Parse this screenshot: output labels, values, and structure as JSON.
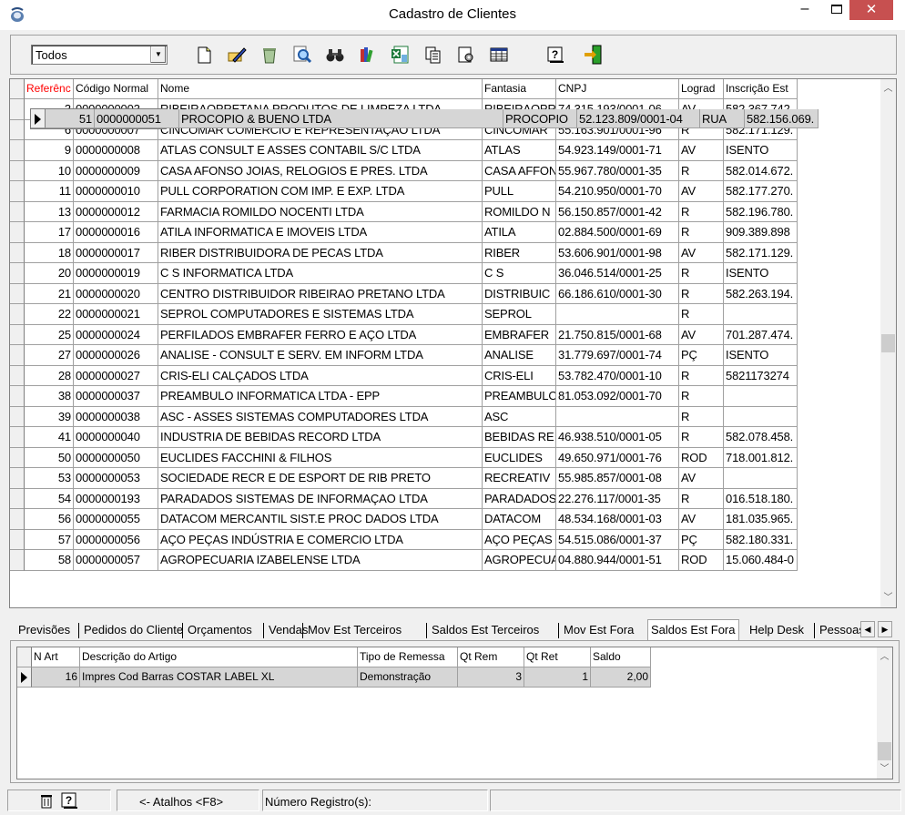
{
  "window": {
    "title": "Cadastro de Clientes",
    "minimize": "–",
    "close": "✕"
  },
  "toolbar": {
    "filter_value": "Todos",
    "icons": [
      "new-document-icon",
      "edit-icon",
      "recycle-bin-icon",
      "search-icon",
      "binoculars-icon",
      "bookshelf-icon",
      "excel-export-icon",
      "copy-icon",
      "settings-icon",
      "grid-icon",
      "help-icon",
      "exit-icon"
    ]
  },
  "grid": {
    "columns": [
      "Referênc",
      "Código Normal",
      "Nome",
      "Fantasia",
      "CNPJ",
      "Lograd",
      "Inscrição Est"
    ],
    "header_color_first": "#ff0000",
    "selected_index": 18,
    "rows": [
      [
        "3",
        "0000000003",
        "RIBEIRAOPRETANA PRODUTOS DE LIMPEZA LTDA",
        "RIBEIRAOPRE",
        "74.315.193/0001-06",
        "AV",
        "582.367.742."
      ],
      [
        "6",
        "0000000007",
        "CINCOMAR COMERCIO E REPRESENTAÇAO LTDA",
        "CINCOMAR",
        "55.163.901/0001-96",
        "R",
        "582.171.129."
      ],
      [
        "9",
        "0000000008",
        "ATLAS CONSULT E ASSES CONTABIL S/C LTDA",
        "ATLAS",
        "54.923.149/0001-71",
        "AV",
        "ISENTO"
      ],
      [
        "10",
        "0000000009",
        "CASA AFONSO JOIAS, RELOGIOS E PRES. LTDA",
        "CASA AFFON",
        "55.967.780/0001-35",
        "R",
        "582.014.672."
      ],
      [
        "11",
        "0000000010",
        "PULL CORPORATION COM IMP. E EXP. LTDA",
        "PULL",
        "54.210.950/0001-70",
        "AV",
        "582.177.270."
      ],
      [
        "13",
        "0000000012",
        "FARMACIA ROMILDO NOCENTI LTDA",
        "ROMILDO N",
        "56.150.857/0001-42",
        "R",
        "582.196.780."
      ],
      [
        "17",
        "0000000016",
        "ATILA INFORMATICA E IMOVEIS LTDA",
        "ATILA",
        "02.884.500/0001-69",
        "R",
        "909.389.898"
      ],
      [
        "18",
        "0000000017",
        "RIBER DISTRIBUIDORA DE PECAS LTDA",
        "RIBER",
        "53.606.901/0001-98",
        "AV",
        "582.171.129."
      ],
      [
        "20",
        "0000000019",
        "C S INFORMATICA LTDA",
        "C S",
        "36.046.514/0001-25",
        "R",
        "ISENTO"
      ],
      [
        "21",
        "0000000020",
        "CENTRO DISTRIBUIDOR RIBEIRAO PRETANO LTDA",
        "DISTRIBUIC",
        "66.186.610/0001-30",
        "R",
        "582.263.194."
      ],
      [
        "22",
        "0000000021",
        "SEPROL COMPUTADORES E SISTEMAS LTDA",
        "SEPROL",
        "",
        "R",
        ""
      ],
      [
        "25",
        "0000000024",
        "PERFILADOS EMBRAFER FERRO E AÇO LTDA",
        "EMBRAFER",
        "21.750.815/0001-68",
        "AV",
        "701.287.474."
      ],
      [
        "27",
        "0000000026",
        "ANALISE - CONSULT E SERV. EM INFORM LTDA",
        "ANALISE",
        "31.779.697/0001-74",
        "PÇ",
        "ISENTO"
      ],
      [
        "28",
        "0000000027",
        "CRIS-ELI CALÇADOS LTDA",
        "CRIS-ELI",
        "53.782.470/0001-10",
        "R",
        "5821173274"
      ],
      [
        "38",
        "0000000037",
        "PREAMBULO INFORMATICA LTDA - EPP",
        "PREAMBULO",
        "81.053.092/0001-70",
        "R",
        ""
      ],
      [
        "39",
        "0000000038",
        "ASC - ASSES SISTEMAS COMPUTADORES LTDA",
        "ASC",
        "",
        "R",
        ""
      ],
      [
        "41",
        "0000000040",
        "INDUSTRIA DE BEBIDAS RECORD LTDA",
        "BEBIDAS RE",
        "46.938.510/0001-05",
        "R",
        "582.078.458."
      ],
      [
        "50",
        "0000000050",
        "EUCLIDES FACCHINI & FILHOS",
        "EUCLIDES",
        "49.650.971/0001-76",
        "ROD",
        "718.001.812."
      ],
      [
        "51",
        "0000000051",
        "PROCOPIO & BUENO LTDA",
        "PROCOPIO",
        "52.123.809/0001-04",
        "RUA",
        "582.156.069."
      ],
      [
        "53",
        "0000000053",
        "SOCIEDADE RECR E DE ESPORT DE RIB PRETO",
        "RECREATIV",
        "55.985.857/0001-08",
        "AV",
        ""
      ],
      [
        "54",
        "0000000193",
        "PARADADOS SISTEMAS DE INFORMAÇAO LTDA",
        "PARADADOS",
        "22.276.117/0001-35",
        "R",
        "016.518.180."
      ],
      [
        "56",
        "0000000055",
        "DATACOM MERCANTIL SIST.E PROC DADOS LTDA",
        "DATACOM",
        "48.534.168/0001-03",
        "AV",
        "181.035.965."
      ],
      [
        "57",
        "0000000056",
        "AÇO PEÇAS INDÚSTRIA E COMERCIO LTDA",
        "AÇO PEÇAS",
        "54.515.086/0001-37",
        "PÇ",
        "582.180.331."
      ],
      [
        "58",
        "0000000057",
        "AGROPECUARIA IZABELENSE LTDA",
        "AGROPECUA",
        "04.880.944/0001-51",
        "ROD",
        "15.060.484-0"
      ]
    ]
  },
  "tabs": [
    "Previsões",
    "Pedidos do Cliente",
    "Orçamentos",
    "Vendas",
    "Mov Est Terceiros",
    "Saldos Est Terceiros",
    "Mov Est Fora",
    "Saldos Est Fora",
    "Help Desk",
    "Pessoas"
  ],
  "active_tab": "Saldos Est Fora",
  "subgrid": {
    "columns": [
      "N Art",
      "Descrição do Artigo",
      "Tipo de Remessa",
      "Qt Rem",
      "Qt Ret",
      "Saldo"
    ],
    "rows": [
      [
        "16",
        "Impres Cod Barras COSTAR LABEL XL",
        "Demonstração",
        "3",
        "1",
        "2,00"
      ]
    ]
  },
  "statusbar": {
    "shortcuts": "<- Atalhos <F8>",
    "record_count_label": "Número Registro(s):"
  }
}
